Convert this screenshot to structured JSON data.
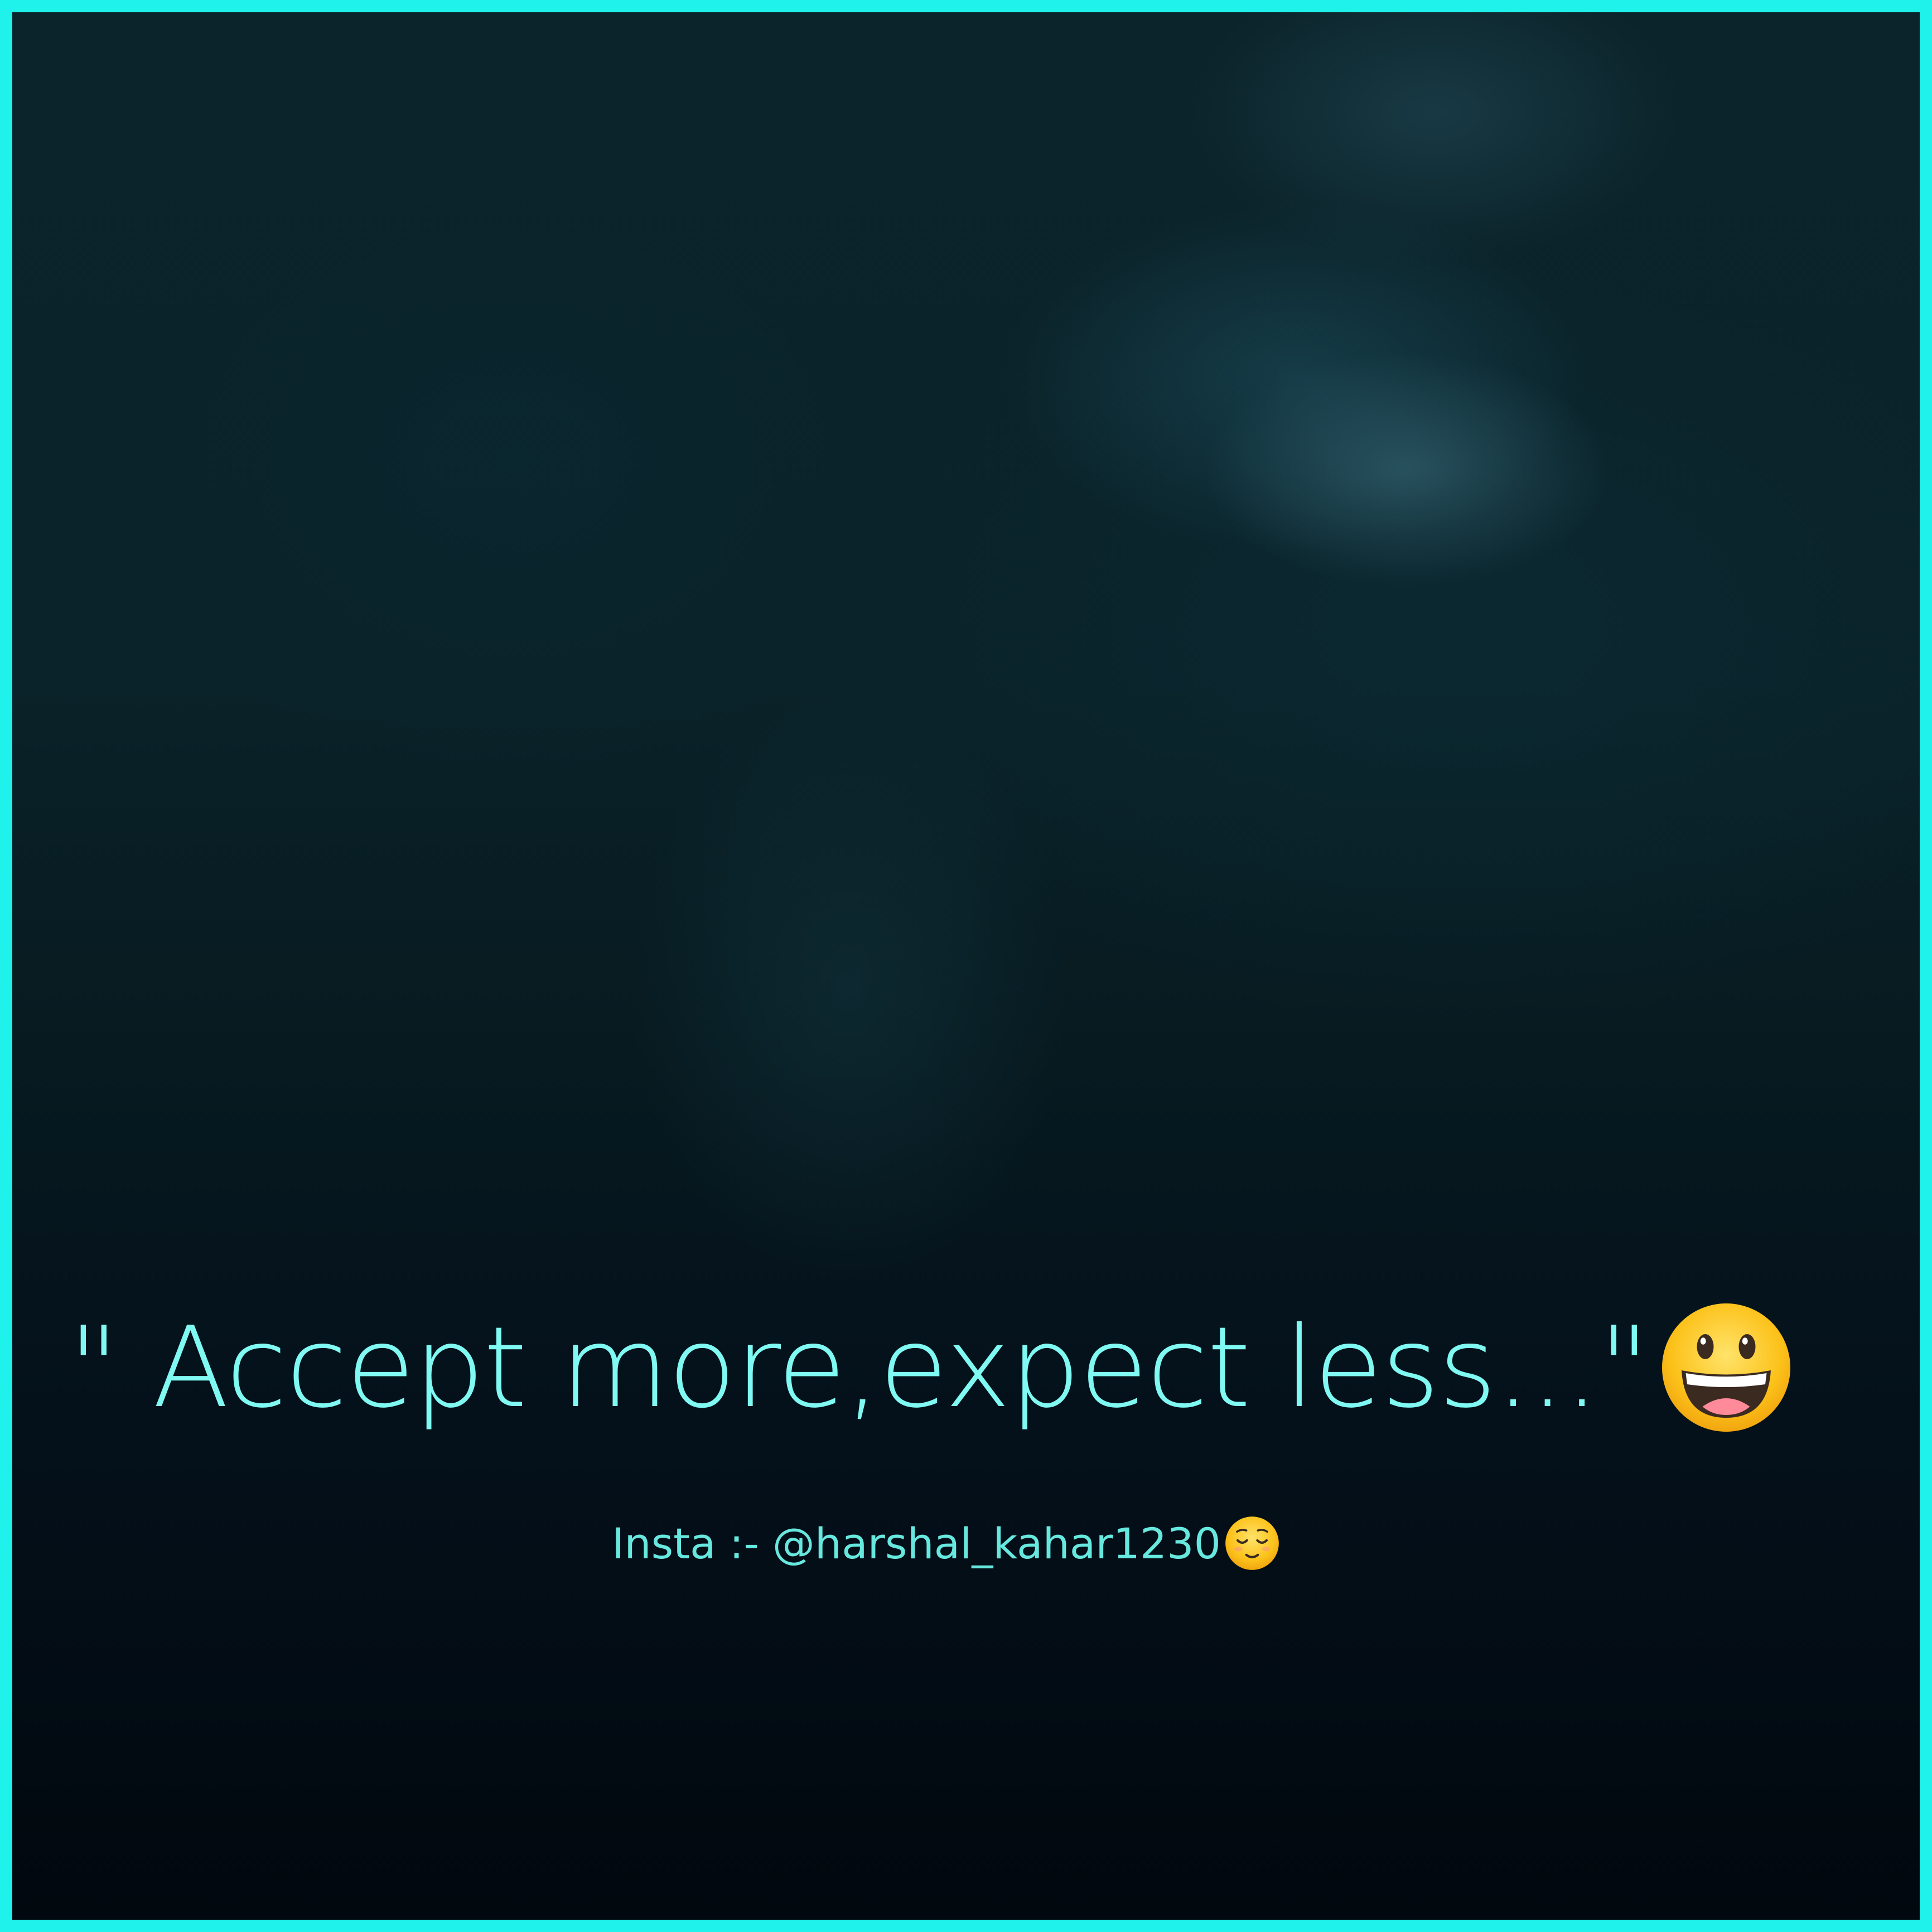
{
  "quote": {
    "text": "\" Accept more,expect less...\"",
    "emoji": "grinning-face-icon"
  },
  "credit": {
    "text": "Insta :- @harshal_kahar1230",
    "emoji": "relieved-face-icon"
  },
  "colors": {
    "border": "#1ff2ea",
    "quote_text": "#7ff9f2",
    "credit_text": "#67e8df",
    "background": "#0a2229"
  }
}
